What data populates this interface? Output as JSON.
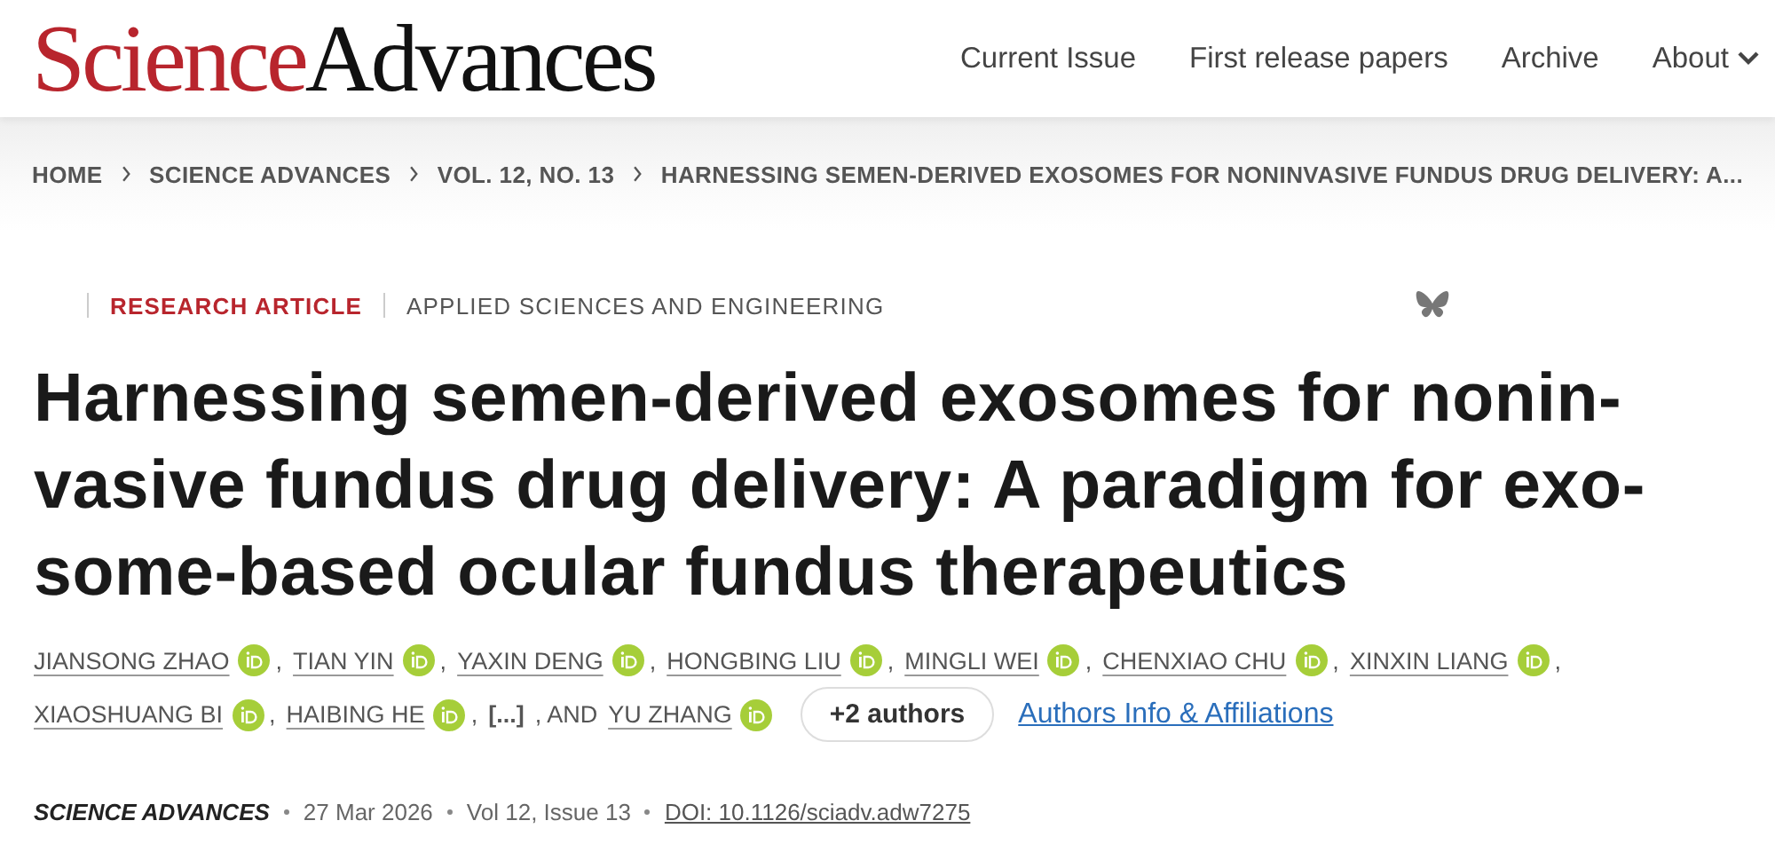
{
  "header": {
    "logo": {
      "part_1": "Science",
      "part_2": "Advances"
    },
    "nav": [
      {
        "label": "Current Issue",
        "has_menu": false
      },
      {
        "label": "First release papers",
        "has_menu": false
      },
      {
        "label": "Archive",
        "has_menu": false
      },
      {
        "label": "About",
        "has_menu": true
      }
    ]
  },
  "breadcrumbs": [
    "HOME",
    "SCIENCE ADVANCES",
    "VOL. 12, NO. 13",
    "HARNESSING SEMEN-DERIVED EXOSOMES FOR NONINVASIVE FUNDUS DRUG DELIVERY: A..."
  ],
  "article": {
    "type": "RESEARCH ARTICLE",
    "subject": "APPLIED SCIENCES AND ENGINEERING",
    "title": [
      "Harnessing semen-derived exosomes for nonin-",
      "vasive fundus drug delivery: A paradigm for exo-",
      "some-based ocular fundus therapeutics"
    ],
    "authors": [
      {
        "kind": "author",
        "name": "JIANSONG ZHAO",
        "orcid": true,
        "sep": ","
      },
      {
        "kind": "author",
        "name": "TIAN YIN",
        "orcid": true,
        "sep": ","
      },
      {
        "kind": "author",
        "name": "YAXIN DENG",
        "orcid": true,
        "sep": ","
      },
      {
        "kind": "author",
        "name": "HONGBING LIU",
        "orcid": true,
        "sep": ","
      },
      {
        "kind": "author",
        "name": "MINGLI WEI",
        "orcid": true,
        "sep": ","
      },
      {
        "kind": "author",
        "name": "CHENXIAO CHU",
        "orcid": true,
        "sep": ","
      },
      {
        "kind": "author",
        "name": "XINXIN LIANG",
        "orcid": true,
        "sep": ","
      },
      {
        "kind": "author",
        "name": "XIAOSHUANG BI",
        "orcid": true,
        "sep": ","
      },
      {
        "kind": "author",
        "name": "HAIBING HE",
        "orcid": true,
        "sep": ","
      },
      {
        "kind": "ellipsis",
        "name": "[...]"
      },
      {
        "kind": "text",
        "name": ", AND"
      },
      {
        "kind": "author",
        "name": "YU ZHANG",
        "orcid": true
      }
    ],
    "more_authors": "+2 authors",
    "affiliations_link": "Authors Info & Affiliations",
    "journal": "SCIENCE ADVANCES",
    "date": "27 Mar 2026",
    "issue": "Vol 12, Issue 13",
    "doi": "DOI: 10.1126/sciadv.adw7275"
  }
}
